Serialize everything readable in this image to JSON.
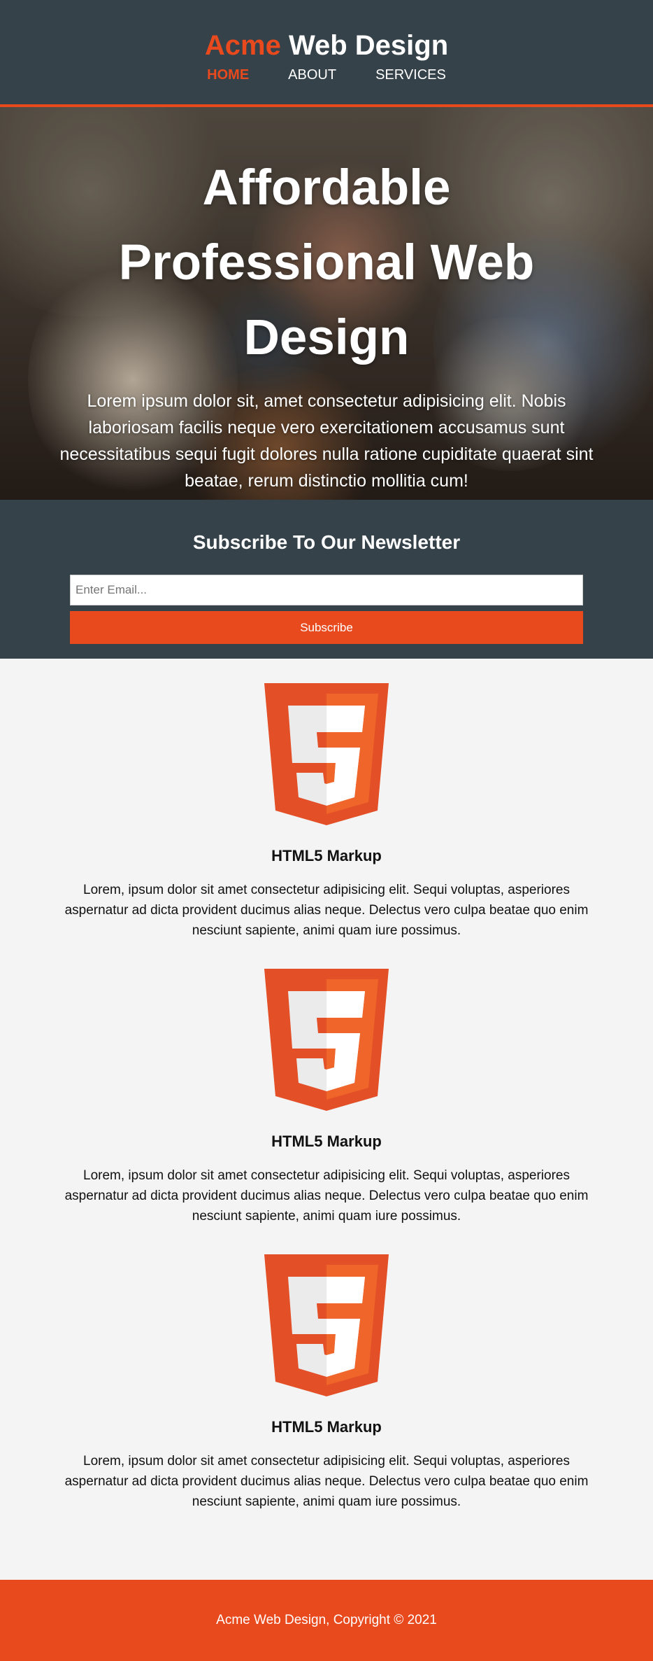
{
  "header": {
    "brand_accent": "Acme",
    "brand_rest": " Web Design",
    "nav": [
      {
        "label": "HOME",
        "current": true
      },
      {
        "label": "ABOUT",
        "current": false
      },
      {
        "label": "SERVICES",
        "current": false
      }
    ]
  },
  "showcase": {
    "title": "Affordable Professional Web Design",
    "text": "Lorem ipsum dolor sit, amet consectetur adipisicing elit. Nobis laboriosam facilis neque vero exercitationem accusamus sunt necessitatibus sequi fugit dolores nulla ratione cupiditate quaerat sint beatae, rerum distinctio mollitia cum!"
  },
  "newsletter": {
    "title": "Subscribe To Our Newsletter",
    "email_placeholder": "Enter Email...",
    "email_value": "",
    "button_label": "Subscribe"
  },
  "boxes": [
    {
      "icon": "html5-logo-icon",
      "title": "HTML5 Markup",
      "text": "Lorem, ipsum dolor sit amet consectetur adipisicing elit. Sequi voluptas, asperiores aspernatur ad dicta provident ducimus alias neque. Delectus vero culpa beatae quo enim nesciunt sapiente, animi quam iure possimus."
    },
    {
      "icon": "html5-logo-icon",
      "title": "HTML5 Markup",
      "text": "Lorem, ipsum dolor sit amet consectetur adipisicing elit. Sequi voluptas, asperiores aspernatur ad dicta provident ducimus alias neque. Delectus vero culpa beatae quo enim nesciunt sapiente, animi quam iure possimus."
    },
    {
      "icon": "html5-logo-icon",
      "title": "HTML5 Markup",
      "text": "Lorem, ipsum dolor sit amet consectetur adipisicing elit. Sequi voluptas, asperiores aspernatur ad dicta provident ducimus alias neque. Delectus vero culpa beatae quo enim nesciunt sapiente, animi quam iure possimus."
    }
  ],
  "footer": {
    "text": "Acme Web Design, Copyright © 2021"
  },
  "colors": {
    "dark": "#35424a",
    "accent": "#e8491d",
    "light": "#f4f4f4"
  }
}
